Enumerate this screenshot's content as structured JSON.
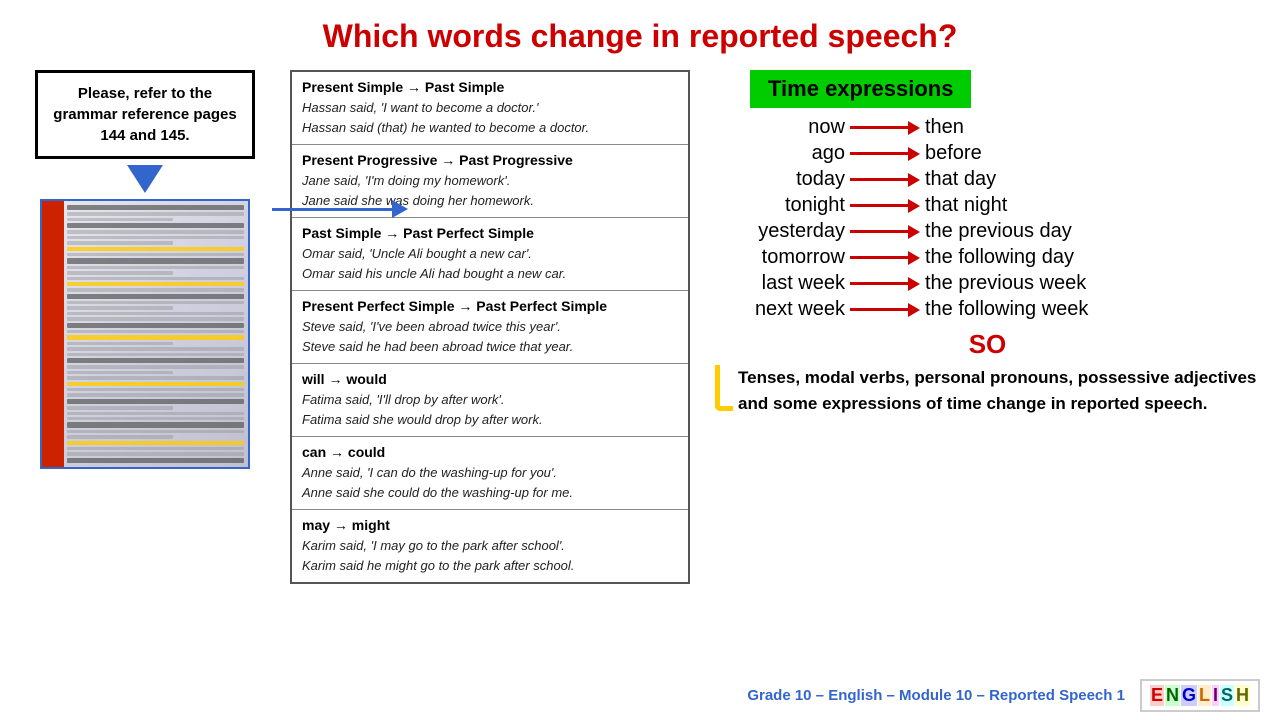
{
  "title": "Which words change in reported speech?",
  "grammar_box": {
    "text": "Please, refer to the grammar reference pages 144 and 145."
  },
  "time_expressions": {
    "header": "Time expressions",
    "rows": [
      {
        "left": "now",
        "right": "then"
      },
      {
        "left": "ago",
        "right": "before"
      },
      {
        "left": "today",
        "right": "that day"
      },
      {
        "left": "tonight",
        "right": "that night"
      },
      {
        "left": "yesterday",
        "right": "the previous day"
      },
      {
        "left": "tomorrow",
        "right": "the following day"
      },
      {
        "left": "last week",
        "right": "the previous week"
      },
      {
        "left": "next week",
        "right": "the following week"
      }
    ]
  },
  "so_section": {
    "label": "SO",
    "text": "Tenses, modal verbs, personal pronouns, possessive adjectives and some expressions of time change in reported speech."
  },
  "grammar_sections": [
    {
      "title": "Present Simple → Past Simple",
      "examples": [
        "Hassan said, 'I want to become a doctor.'",
        "Hassan said (that) he wanted to become a doctor."
      ]
    },
    {
      "title": "Present Progressive → Past Progressive",
      "examples": [
        "Jane said, 'I'm doing my homework'.",
        "Jane said she was doing her homework."
      ]
    },
    {
      "title": "Past Simple → Past Perfect Simple",
      "examples": [
        "Omar said, 'Uncle Ali bought a new car'.",
        "Omar said his uncle Ali had bought a new car."
      ]
    },
    {
      "title": "Present Perfect Simple → Past Perfect Simple",
      "examples": [
        "Steve said, 'I've been abroad twice this year'.",
        "Steve said he had been abroad twice that year."
      ]
    },
    {
      "title": "will → would",
      "examples": [
        "Fatima said, 'I'll drop by after work'.",
        "Fatima said she would drop by after work."
      ]
    },
    {
      "title": "can → could",
      "examples": [
        "Anne said, 'I can do the washing-up for you'.",
        "Anne said she could do the washing-up for me."
      ]
    },
    {
      "title": "may → might",
      "examples": [
        "Karim said, 'I may go to the park after school'.",
        "Karim said he might go to the park after school."
      ]
    }
  ],
  "footer": {
    "text": "Grade 10 – English – Module 10 – Reported Speech 1",
    "badge_letters": [
      "E",
      "N",
      "G",
      "L",
      "I",
      "S",
      "H"
    ]
  }
}
